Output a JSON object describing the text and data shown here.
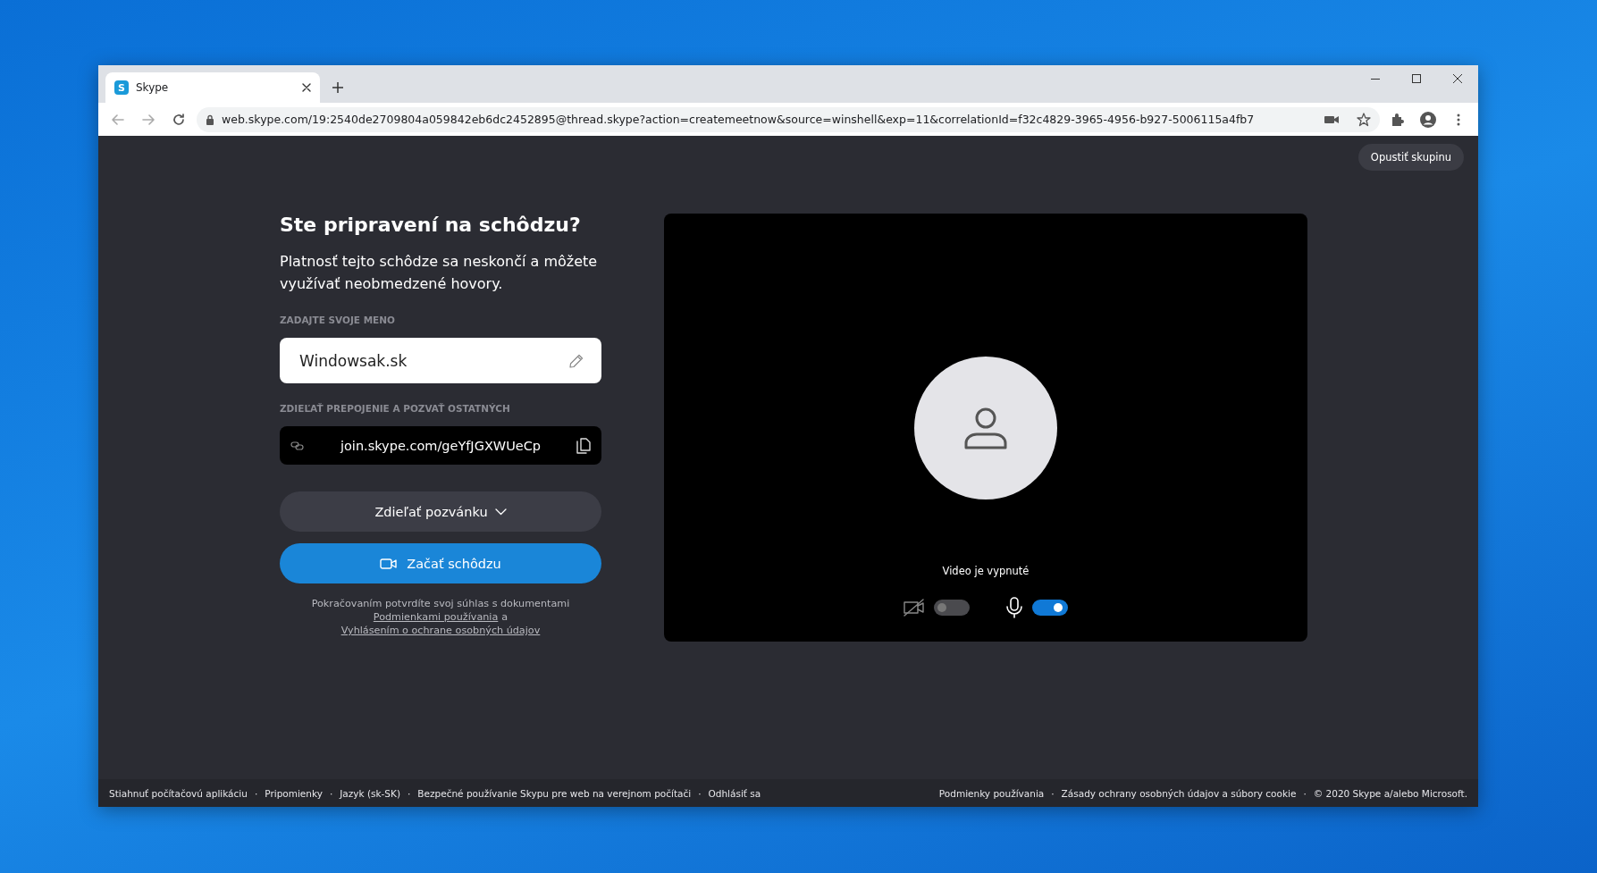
{
  "browser": {
    "tab": {
      "favicon_letter": "S",
      "title": "Skype",
      "selected": true
    },
    "address": "web.skype.com/19:2540de2709804a059842eb6dc2452895@thread.skype?action=createmeetnow&source=winshell&exp=11&correlationId=f32c4829-3965-4956-b927-5006115a4fb7"
  },
  "leave_button": "Opustiť skupinu",
  "join": {
    "heading": "Ste pripravení na schôdzu?",
    "subheading": "Platnosť tejto schôdze sa neskončí a môžete využívať neobmedzené hovory.",
    "name_label": "ZADAJTE SVOJE MENO",
    "name_value": "Windowsak.sk",
    "link_label": "ZDIEĽAŤ PREPOJENIE A POZVAŤ OSTATNÝCH",
    "link": "join.skype.com/geYfJGXWUeCp",
    "share_button": "Zdieľať pozvánku",
    "start_button": "Začať schôdzu",
    "consent": "Pokračovaním potvrdíte svoj súhlas s dokumentami",
    "terms_link": "Podmienkami používania",
    "and": "a",
    "privacy_link": "Vyhlásením o ochrane osobných údajov"
  },
  "preview": {
    "status": "Video je vypnuté",
    "video_toggle": {
      "on": false
    },
    "mic_toggle": {
      "on": true
    }
  },
  "footer": {
    "separator": "·",
    "left": [
      "Stiahnuť počítačovú aplikáciu",
      "Pripomienky",
      "Jazyk (sk-SK)",
      "Bezpečné používanie Skypu pre web na verejnom počítači",
      "Odhlásiť sa"
    ],
    "right": [
      "Podmienky používania",
      "Zásady ochrany osobných údajov a súbory cookie",
      "© 2020 Skype a/alebo Microsoft."
    ]
  }
}
